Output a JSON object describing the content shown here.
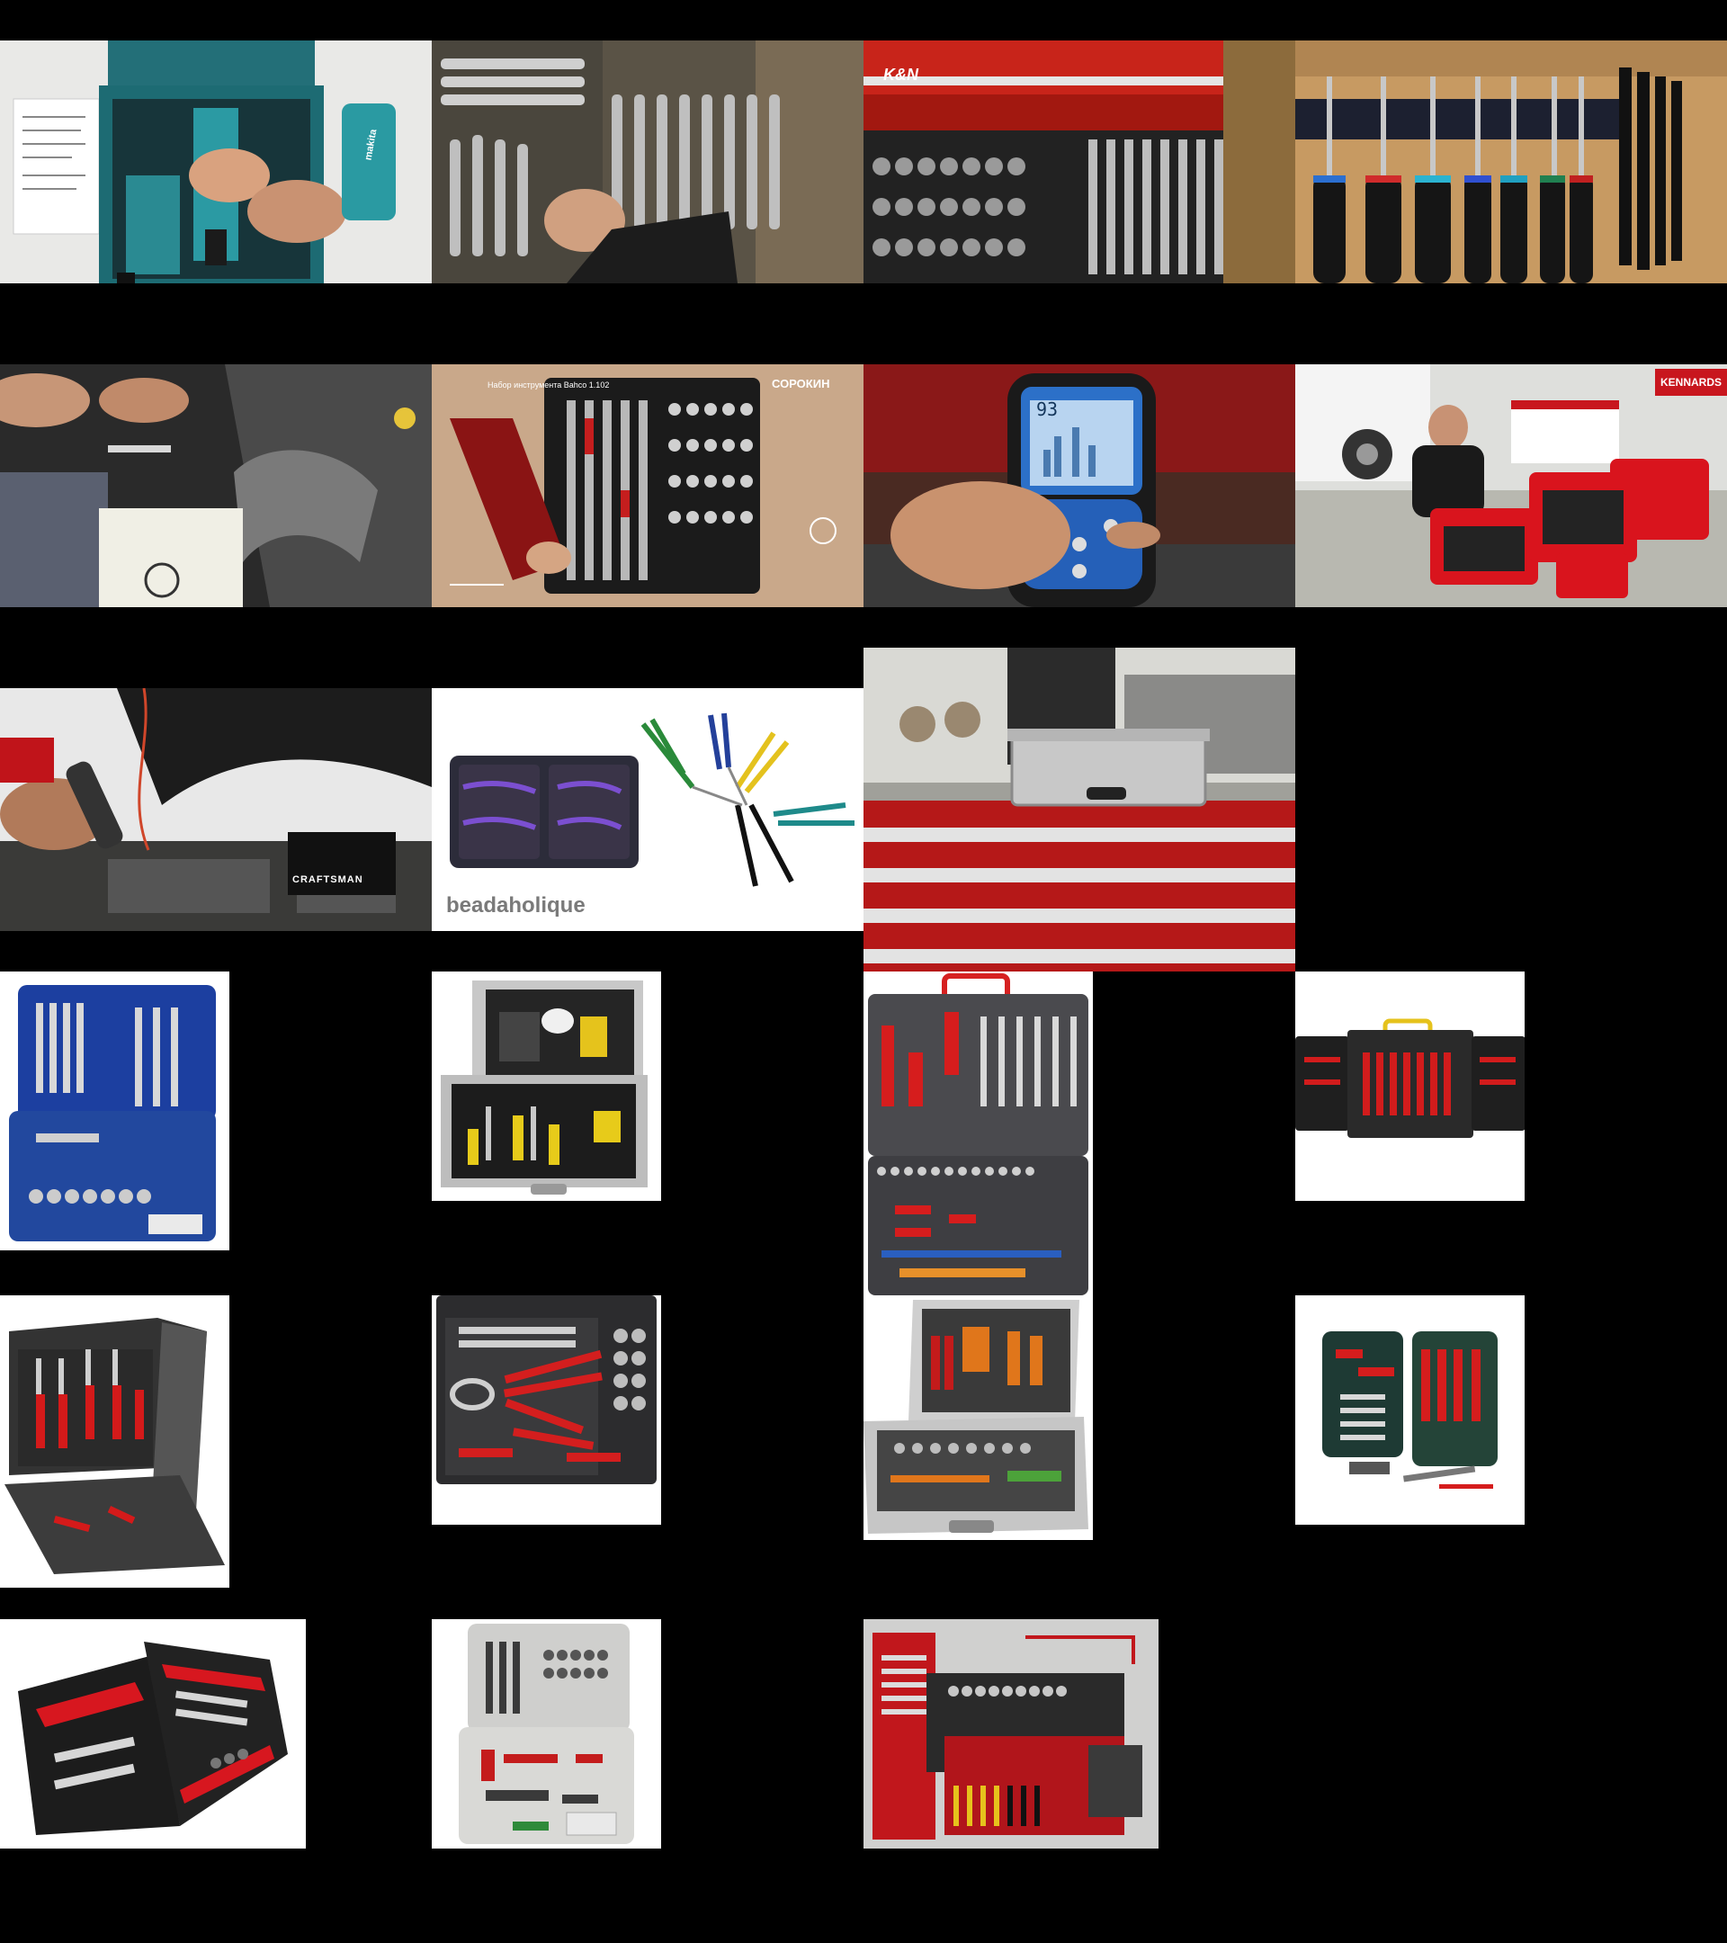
{
  "page": {
    "background": "#000000"
  },
  "images": [
    {
      "id": "r1c1",
      "subject": "cordless drill in teal carry case",
      "texts": {
        "brand": "makita"
      }
    },
    {
      "id": "r1c2",
      "subject": "combination wrenches in drawer"
    },
    {
      "id": "r1c3",
      "subject": "red tool chest with sockets",
      "texts": {
        "brand": "K&N"
      }
    },
    {
      "id": "r1c4",
      "subject": "screwdrivers on magnetic wall rail"
    },
    {
      "id": "r2c1",
      "subject": "hands using tool in engine bay"
    },
    {
      "id": "r2c2",
      "subject": "socket set in black case",
      "texts": {
        "caption": "Набор инструмента Bahco 1.102",
        "brand": "СОРОКИН"
      }
    },
    {
      "id": "r2c3",
      "subject": "hand holding digital gauge",
      "texts": {
        "reading": "93"
      }
    },
    {
      "id": "r2c4",
      "subject": "man with red power tool cases",
      "texts": {
        "sign": "KENNARDS"
      }
    },
    {
      "id": "r3c1",
      "subject": "mechanic working under car hood",
      "texts": {
        "brand": "CRAFTSMAN"
      }
    },
    {
      "id": "r3c2",
      "subject": "jewelry pliers set in zip case",
      "texts": {
        "brand": "beadaholique"
      }
    },
    {
      "id": "r3c3",
      "subject": "aluminium case on red workbench"
    },
    {
      "id": "r4c1",
      "subject": "blue tool case kit"
    },
    {
      "id": "r4c2",
      "subject": "aluminium electronics tool case"
    },
    {
      "id": "r4c3",
      "subject": "grey tool case with red handled tools"
    },
    {
      "id": "r4c4",
      "subject": "black screwdriver set case"
    },
    {
      "id": "r5c1",
      "subject": "black tool bag with pliers"
    },
    {
      "id": "r5c2",
      "subject": "black case with pliers and sockets"
    },
    {
      "id": "r5c3",
      "subject": "aluminium case with orange tools"
    },
    {
      "id": "r5c4",
      "subject": "green tool kit with hammer"
    },
    {
      "id": "r6c1",
      "subject": "red and black zip tool pouch"
    },
    {
      "id": "r6c2",
      "subject": "white case tool set"
    },
    {
      "id": "r6c3",
      "subject": "tool chest with tools on display"
    }
  ]
}
